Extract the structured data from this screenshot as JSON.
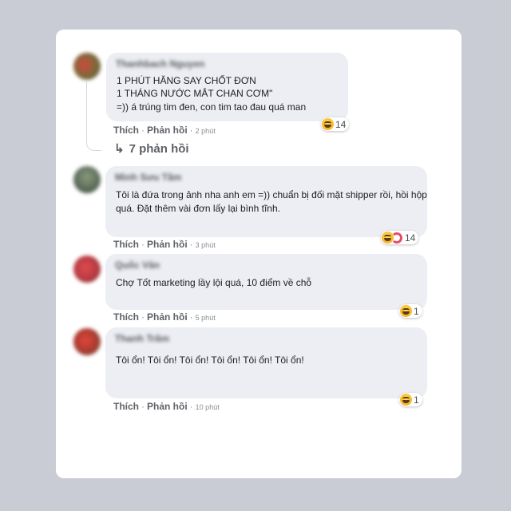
{
  "comments": [
    {
      "author": "Thanhbach Nguyen",
      "lines": [
        "1 PHÚT HĂNG SAY CHỐT ĐƠN",
        "1 THÁNG NƯỚC MẮT CHAN CƠM\"",
        "=)) á trúng tim đen, con tim tao đau quá man"
      ],
      "like": "Thích",
      "reply": "Phản hồi",
      "time": "2 phút",
      "reaction_count": "14",
      "avatar_color": "#8a6a3a"
    },
    {
      "author": "Minh Sưu Tầm",
      "lines": [
        "Tôi là đứa trong ảnh nha anh em =)) chuẩn bị đối mặt shipper rồi, hồi hộp",
        "quá. Đặt thêm vài đơn lấy lại bình tĩnh."
      ],
      "like": "Thích",
      "reply": "Phản hồi",
      "time": "3 phút",
      "reaction_count": "14",
      "avatar_color": "#6e7a6a"
    },
    {
      "author": "Quốc Văn",
      "lines": [
        "Chợ Tốt marketing lầy lội quá, 10 điểm về chỗ"
      ],
      "like": "Thích",
      "reply": "Phản hồi",
      "time": "5 phút",
      "reaction_count": "1",
      "avatar_color": "#c0404a"
    },
    {
      "author": "Thanh Trâm",
      "lines": [
        "Tôi ổn! Tôi ổn! Tôi ổn! Tôi ổn! Tôi ổn! Tôi ổn!"
      ],
      "like": "Thích",
      "reply": "Phản hồi",
      "time": "10 phút",
      "reaction_count": "1",
      "avatar_color": "#c8463c"
    }
  ],
  "replies_label": "7 phản hồi",
  "replies_arrow": "↳"
}
